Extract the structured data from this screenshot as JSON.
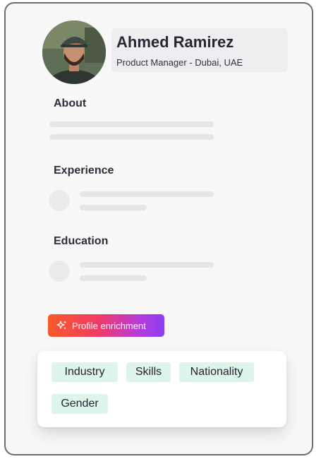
{
  "profile": {
    "name": "Ahmed Ramirez",
    "role": "Product Manager",
    "separator": " - ",
    "location": "Dubai, UAE"
  },
  "sections": {
    "about": "About",
    "experience": "Experience",
    "education": "Education"
  },
  "enrichment": {
    "button_label": "Profile enrichment",
    "icon": "sparkles-icon",
    "gradient": [
      "#f75a26",
      "#ef3a6a",
      "#b23ce0",
      "#8a3ff0"
    ]
  },
  "tags": [
    "Industry",
    "Skills",
    "Nationality",
    "Gender"
  ],
  "colors": {
    "tag_bg": "#dff4ea",
    "placeholder": "#e6e6e9",
    "text": "#242833"
  }
}
